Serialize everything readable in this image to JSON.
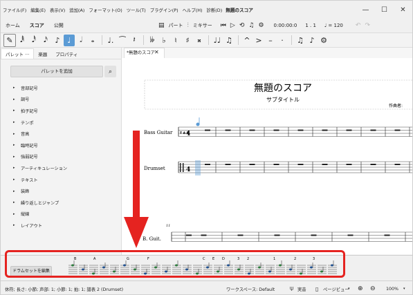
{
  "menu": [
    "ファイル(F)",
    "編集(E)",
    "表示(V)",
    "追加(A)",
    "フォーマット(O)",
    "ツール(T)",
    "プラグイン(P)",
    "ヘルプ(H)",
    "診断(D)"
  ],
  "window_title": "無題のスコア",
  "window_controls": {
    "minimize": "—",
    "maximize": "☐",
    "close": "✕"
  },
  "workspace_tabs": [
    "ホーム",
    "スコア",
    "公開"
  ],
  "toolbar": {
    "parts": "パート",
    "mixer": "ミキサー",
    "time": "0:00:00:0",
    "measure_beat": "1 . 1",
    "tempo": "♩ = 120"
  },
  "panel_tabs": [
    "パレット",
    "楽器",
    "プロパティ"
  ],
  "panel_dots": "···",
  "add_palette_label": "パレットを追加",
  "palettes": [
    "音部記号",
    "調号",
    "拍子記号",
    "テンポ",
    "音高",
    "臨時記号",
    "強弱記号",
    "アーティキュレーション",
    "テキスト",
    "装飾",
    "繰り返しとジャンプ",
    "縦線",
    "レイアウト"
  ],
  "document_tab": "*無題のスコア",
  "score": {
    "title": "無題のスコア",
    "subtitle": "サブタイトル",
    "composer": "作曲者:",
    "instruments": [
      "Bass Guitar",
      "Drumset"
    ],
    "system2_label": "B. Guit.",
    "system2_measure": "11"
  },
  "drumset_button": "ドラムセットを編集",
  "drum_letters": [
    "B",
    "A",
    "G",
    "F",
    "C",
    "E",
    "D",
    "3",
    "2",
    "1",
    "2",
    "3"
  ],
  "status": {
    "selection": "休符; 長さ: 小節; 声部: 1; 小節: 1; 拍: 1; 譜表 2 (Drumset)",
    "workspace": "ワークスペース: Default",
    "concert_pitch": "実音",
    "view_mode": "ページビュー",
    "zoom": "100%"
  },
  "colors": {
    "accent": "#5b9bd5",
    "annotation_red": "#e52320"
  }
}
